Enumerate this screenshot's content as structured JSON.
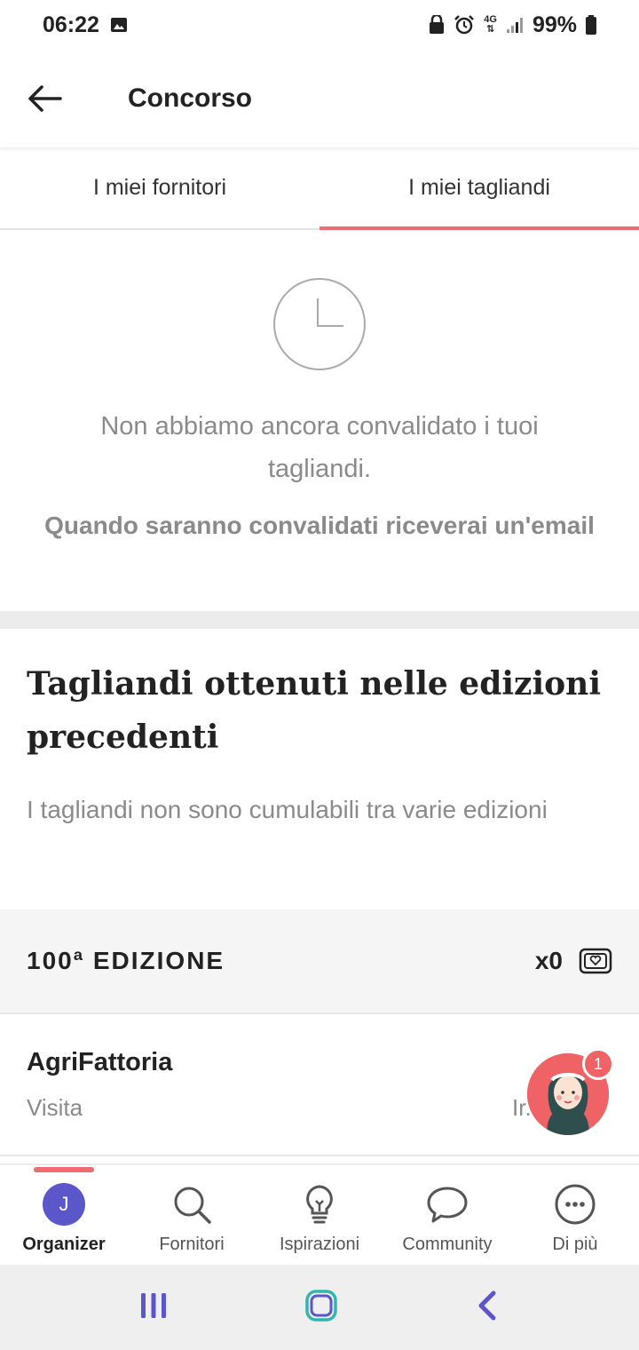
{
  "status_bar": {
    "time": "06:22",
    "network": "4G",
    "battery": "99%"
  },
  "app_bar": {
    "title": "Concorso"
  },
  "tabs": [
    {
      "label": "I miei fornitori",
      "active": false
    },
    {
      "label": "I miei tagliandi",
      "active": true
    }
  ],
  "empty_state": {
    "message": "Non abbiamo ancora convalidato i tuoi tagliandi.",
    "sub_message": "Quando saranno convalidati riceverai un'email"
  },
  "previous_editions": {
    "title": "Tagliandi ottenuti nelle edizioni precedenti",
    "subtitle": "I tagliandi non sono cumulabili tra varie edizioni"
  },
  "edition": {
    "title": "100ª EDIZIONE",
    "count": "x0"
  },
  "supplier": {
    "name": "AgriFattoria",
    "type": "Visita",
    "status_partial": "Ir."
  },
  "chat": {
    "badge": "1"
  },
  "bottom_nav": {
    "items": [
      {
        "label": "Organizer",
        "icon": "avatar-icon",
        "avatar_letter": "J",
        "active": true
      },
      {
        "label": "Fornitori",
        "icon": "search-icon",
        "active": false
      },
      {
        "label": "Ispirazioni",
        "icon": "lightbulb-icon",
        "active": false
      },
      {
        "label": "Community",
        "icon": "chat-bubble-icon",
        "active": false
      },
      {
        "label": "Di più",
        "icon": "more-icon",
        "active": false
      }
    ]
  },
  "colors": {
    "accent": "#f06a6f",
    "avatar": "#5b56c9",
    "muted_text": "#8a8a8a",
    "system_nav": "#5b56c9",
    "home_button": "#2fb6b0"
  }
}
